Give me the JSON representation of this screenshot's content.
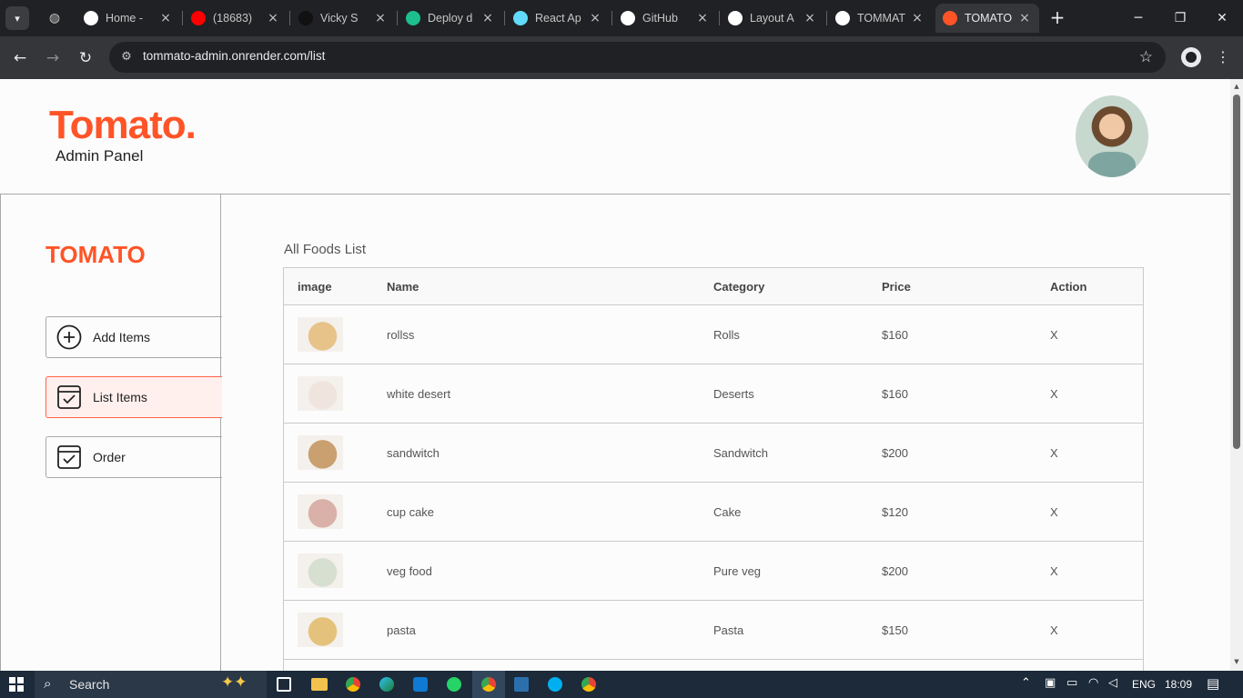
{
  "browser": {
    "tabs": [
      {
        "title": "Home - ",
        "favicon": "triangle-icon",
        "color": "#ffffff"
      },
      {
        "title": "(18683) ",
        "favicon": "youtube-icon",
        "color": "#ff0000"
      },
      {
        "title": "Vicky S",
        "favicon": "upwork-icon",
        "color": "#111111"
      },
      {
        "title": "Deploy d",
        "favicon": "render-icon",
        "color": "#1dbf8e"
      },
      {
        "title": "React Ap",
        "favicon": "react-icon",
        "color": "#61dafb"
      },
      {
        "title": "GitHub",
        "favicon": "github-icon",
        "color": "#ffffff"
      },
      {
        "title": "Layout A",
        "favicon": "openai-icon",
        "color": "#ffffff"
      },
      {
        "title": "TOMMAT",
        "favicon": "tomato-icon",
        "color": "#ffffff"
      },
      {
        "title": "TOMATO",
        "favicon": "tomato-icon",
        "color": "#ff5427",
        "active": true
      }
    ],
    "url": "tommato-admin.onrender.com/list"
  },
  "header": {
    "logo": "Tomato.",
    "subtitle": "Admin Panel"
  },
  "sidebar": {
    "brand": "TOMATO",
    "items": [
      {
        "label": "Add Items",
        "icon": "add-circle-icon"
      },
      {
        "label": "List Items",
        "icon": "checklist-icon",
        "active": true
      },
      {
        "label": "Order",
        "icon": "order-icon"
      }
    ]
  },
  "main": {
    "title": "All Foods List",
    "columns": [
      "image",
      "Name",
      "Category",
      "Price",
      "Action"
    ],
    "rows": [
      {
        "name": "rollss",
        "category": "Rolls",
        "price": "$160",
        "action": "X",
        "img_color": "#e7c38a"
      },
      {
        "name": "white desert",
        "category": "Deserts",
        "price": "$160",
        "action": "X",
        "img_color": "#efe4de"
      },
      {
        "name": "sandwitch",
        "category": "Sandwitch",
        "price": "$200",
        "action": "X",
        "img_color": "#caa070"
      },
      {
        "name": "cup cake",
        "category": "Cake",
        "price": "$120",
        "action": "X",
        "img_color": "#d9b1a9"
      },
      {
        "name": "veg food",
        "category": "Pure veg",
        "price": "$200",
        "action": "X",
        "img_color": "#d6dfd0"
      },
      {
        "name": "pasta",
        "category": "Pasta",
        "price": "$150",
        "action": "X",
        "img_color": "#e5c27c"
      }
    ]
  },
  "taskbar": {
    "search_placeholder": "Search",
    "language": "ENG",
    "time": "18:09"
  }
}
